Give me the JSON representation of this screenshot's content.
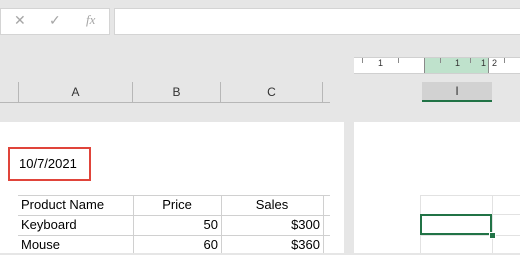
{
  "formula_bar": {
    "cancel_icon": "close-icon",
    "enter_icon": "checkmark-icon",
    "function_icon": "function-icon",
    "cancel_glyph": "✕",
    "enter_glyph": "✓",
    "function_glyph": "fx",
    "value": ""
  },
  "ruler": {
    "labels": [
      "1",
      "1",
      "1",
      "2"
    ]
  },
  "columns": {
    "a": "A",
    "b": "B",
    "c": "C",
    "i": "I"
  },
  "sheet": {
    "date_cell": "10/7/2021",
    "table": {
      "headers": [
        "Product Name",
        "Price",
        "Sales"
      ],
      "rows": [
        {
          "product": "Keyboard",
          "price": "50",
          "sales": "$300"
        },
        {
          "product": "Mouse",
          "price": "60",
          "sales": "$360"
        }
      ]
    }
  },
  "colors": {
    "accent": "#217346",
    "highlight": "#e0443a",
    "ruler_highlight": "#bfe2cc"
  }
}
